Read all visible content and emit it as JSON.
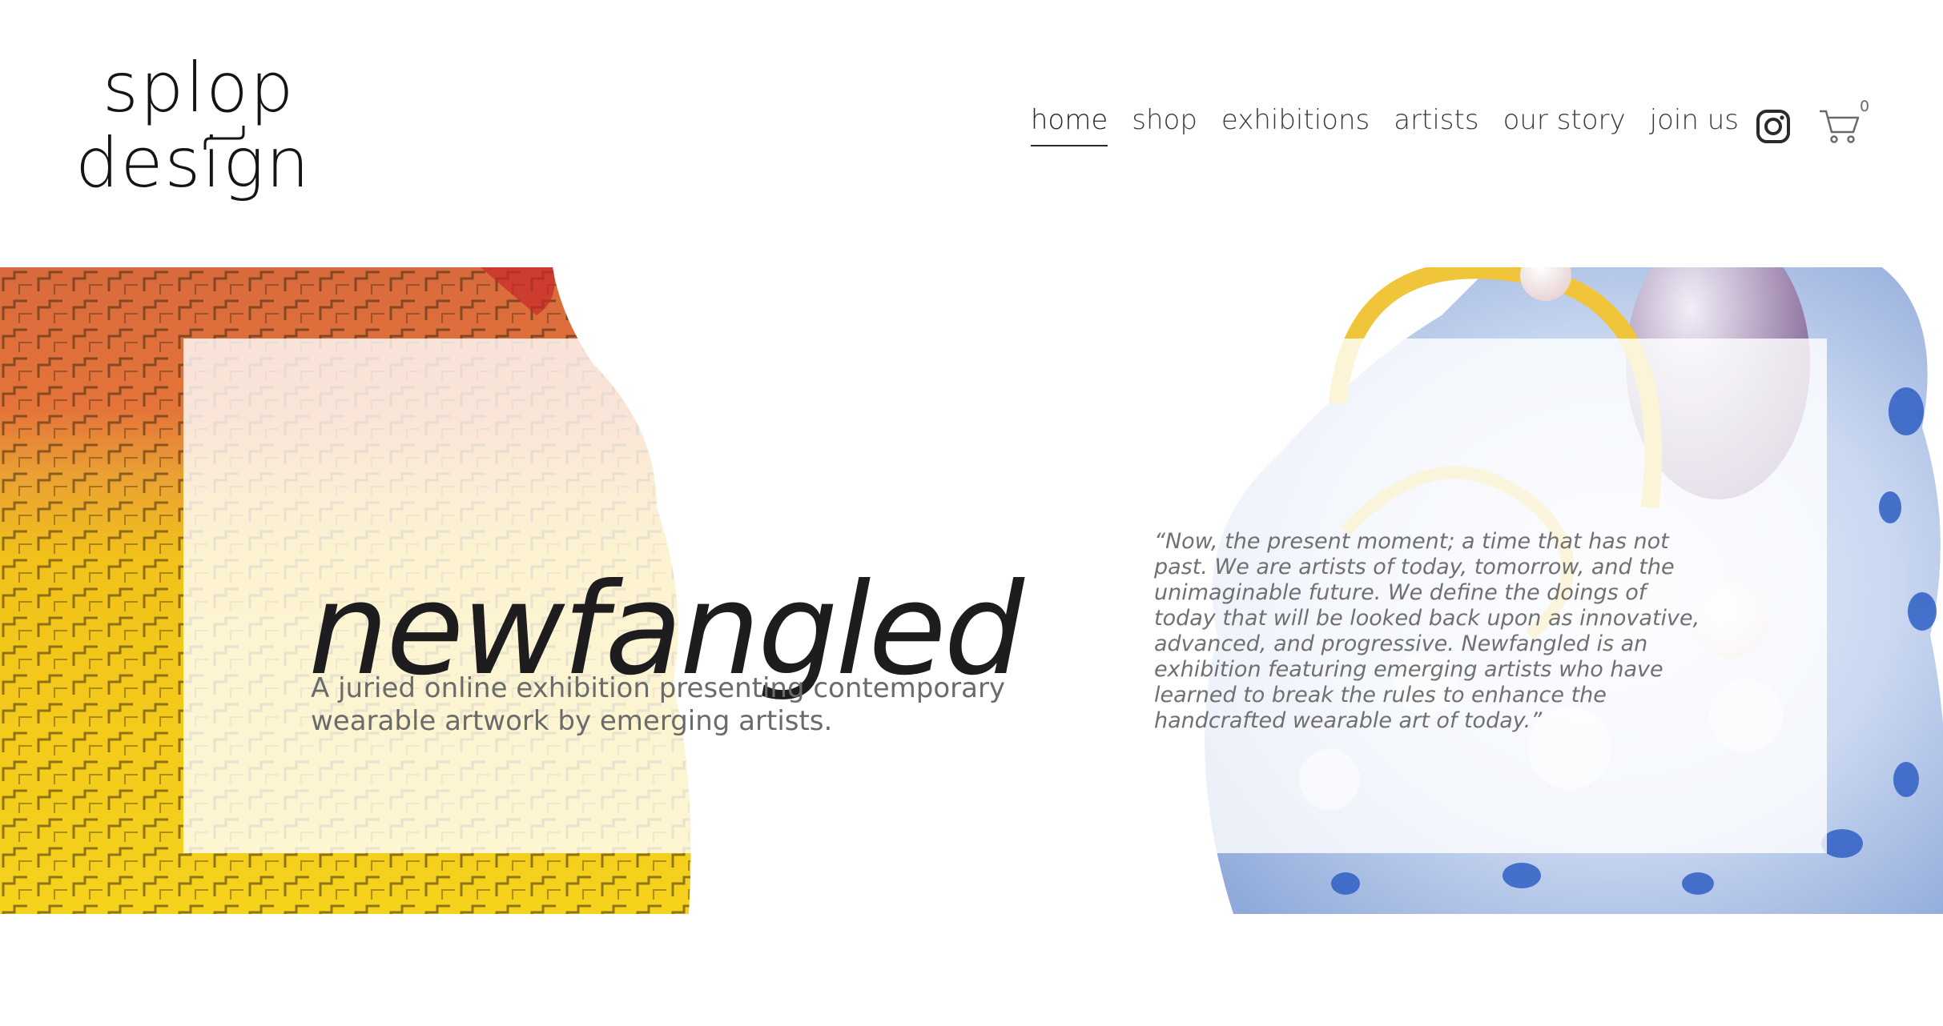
{
  "brand": {
    "logo_line_1": "splop",
    "logo_line_2": "design"
  },
  "nav": {
    "items": [
      {
        "label": "home",
        "active": true
      },
      {
        "label": "shop",
        "active": false
      },
      {
        "label": "exhibitions",
        "active": false
      },
      {
        "label": "artists",
        "active": false
      },
      {
        "label": "our story",
        "active": false
      },
      {
        "label": "join us",
        "active": false
      }
    ],
    "social_icon": "instagram-icon",
    "cart_icon": "cart-icon",
    "cart_count": "0"
  },
  "hero": {
    "title": "newfangled",
    "subtitle": "A juried online exhibition presenting contemporary wearable artwork by emerging artists.",
    "quote": "“Now, the present moment; a time that has not past. We are artists of today, tomorrow, and the unimaginable future. We define the doings of today that will be looked back upon as innovative, advanced, and progressive. Newfangled is an exhibition featuring emerging artists who have learned to break the rules to enhance the handcrafted wearable art of today.”"
  },
  "colors": {
    "text_dark": "#1d1d1f",
    "text_muted": "#6b6b6b",
    "art_orange": "#e0693a",
    "art_yellow": "#f2c418",
    "art_blue": "#2f5fc4"
  }
}
